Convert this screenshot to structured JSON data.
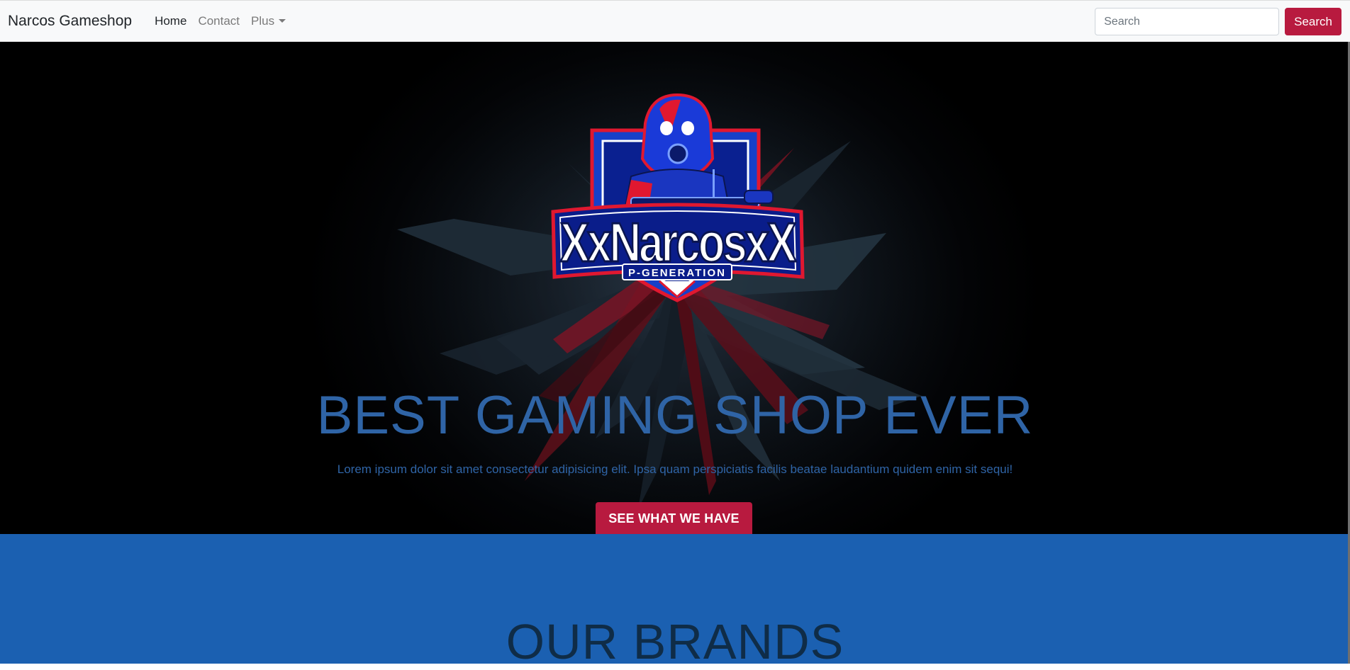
{
  "navbar": {
    "brand": "Narcos Gameshop",
    "links": [
      {
        "label": "Home",
        "active": true
      },
      {
        "label": "Contact",
        "active": false
      },
      {
        "label": "Plus",
        "active": false,
        "dropdown": true
      }
    ],
    "search": {
      "placeholder": "Search",
      "button_label": "Search"
    }
  },
  "hero": {
    "logo": {
      "name_text": "XxNarcosxX",
      "sub_text": "P-GENERATION",
      "icon": "gasmask-soldier-icon"
    },
    "title": "BEST GAMING SHOP EVER",
    "subtitle": "Lorem ipsum dolor sit amet consectetur adipisicing elit. Ipsa quam perspiciatis facilis beatae laudantium quidem enim sit sequi!",
    "cta_label": "SEE WHAT WE HAVE"
  },
  "brands": {
    "title": "OUR BRANDS"
  },
  "colors": {
    "accent": "#b81a3f",
    "hero_text": "#2f64a6",
    "brands_bg": "#1b60b1",
    "navbar_bg": "#f8f9fa"
  }
}
